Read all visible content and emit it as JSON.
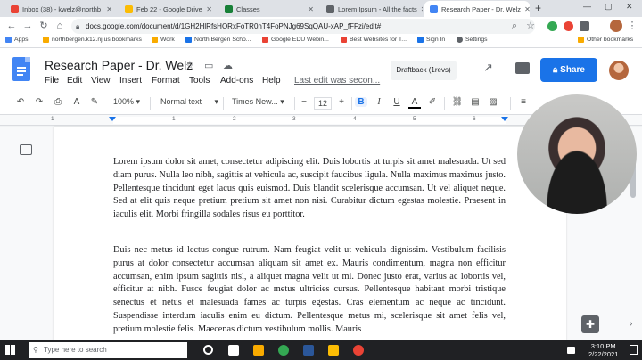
{
  "browser": {
    "tabs": [
      {
        "label": "Inbox (38) - kwelz@northb",
        "color": "#ea4335"
      },
      {
        "label": "Feb 22 - Google Drive",
        "color": "#fbbc04"
      },
      {
        "label": "Classes",
        "color": "#188038"
      },
      {
        "label": "Lorem Ipsum - All the facts",
        "color": "#5f6368"
      },
      {
        "label": "Research Paper - Dr. Welz",
        "color": "#4285f4"
      }
    ],
    "url": "docs.google.com/document/d/1GH2HlRfsHORxFoTR0nT4FoPNJg69SqQAU-xAP_fFFzi/edit#",
    "bookmarks": [
      "Apps",
      "northbergen.k12.nj.us bookmarks",
      "Work",
      "North Bergen Scho...",
      "Google EDU Webin...",
      "Best Websites for T...",
      "Sign In",
      "Settings",
      "Other bookmarks"
    ]
  },
  "docs": {
    "title": "Research Paper - Dr. Welz",
    "menus": [
      "File",
      "Edit",
      "View",
      "Insert",
      "Format",
      "Tools",
      "Add-ons",
      "Help"
    ],
    "last_edit": "Last edit was secon...",
    "draftback": "Draftback (1revs)",
    "share": "Share",
    "toolbar": {
      "zoom": "100%",
      "style": "Normal text",
      "font": "Times New...",
      "font_size": "12",
      "bold": "B",
      "italic": "I",
      "underline": "U",
      "text_color": "A"
    },
    "ruler_numbers": [
      "1",
      "1",
      "2",
      "3",
      "4",
      "5",
      "6"
    ],
    "paragraphs": [
      "Lorem ipsum dolor sit amet, consectetur adipiscing elit. Duis lobortis ut turpis sit amet malesuada. Ut sed diam purus. Nulla leo nibh, sagittis at vehicula ac, suscipit faucibus ligula. Nulla maximus maximus justo. Pellentesque tincidunt eget lacus quis euismod. Duis blandit scelerisque accumsan. Ut vel aliquet neque. Sed at elit quis neque pretium pretium sit amet non nisi. Curabitur dictum egestas molestie. Praesent in iaculis elit. Morbi fringilla sodales risus eu porttitor.",
      "Duis nec metus id lectus congue rutrum. Nam feugiat velit ut vehicula dignissim. Vestibulum facilisis purus at dolor consectetur accumsan aliquam sit amet ex. Mauris condimentum, magna non efficitur accumsan, enim ipsum sagittis nisl, a aliquet magna velit ut mi. Donec justo erat, varius ac lobortis vel, efficitur at nibh. Fusce feugiat dolor ac metus ultricies cursus. Pellentesque habitant morbi tristique senectus et netus et malesuada fames ac turpis egestas. Cras elementum ac neque ac tincidunt. Suspendisse interdum iaculis enim eu dictum. Pellentesque metus mi, scelerisque sit amet felis vel, pretium molestie felis. Maecenas dictum vestibulum mollis. Mauris"
    ]
  },
  "taskbar": {
    "search_placeholder": "Type here to search",
    "time": "3:10 PM",
    "date": "2/22/2021"
  }
}
